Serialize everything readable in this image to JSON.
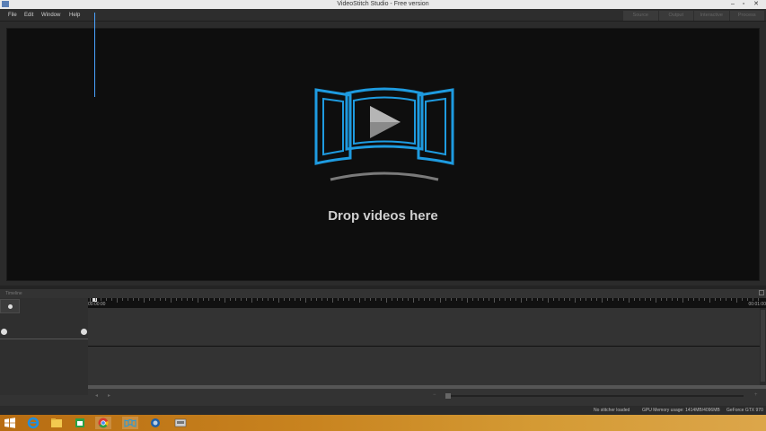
{
  "window": {
    "title": "VideoStitch Studio - Free version",
    "min": "–",
    "max": "▫",
    "close": "✕"
  },
  "menu": [
    "File",
    "Edit",
    "Window",
    "Help"
  ],
  "mode_tabs": [
    "Source",
    "Output",
    "Interactive",
    "Process"
  ],
  "viewer": {
    "drop_text": "Drop videos here"
  },
  "timeline": {
    "label": "Timeline",
    "start_time": "00:00:00",
    "end_time": "00:01:00",
    "prev_btn": "◂",
    "next_btn": "▸",
    "zoom_out": "−",
    "zoom_in": "+"
  },
  "status": {
    "stitcher": "No stitcher loaded",
    "gpu_memory": "GPU Memory usage: 1414MB/4096MB",
    "gpu": "GeForce GTX 970"
  },
  "taskbar": {
    "icons": [
      "windows-start-icon",
      "internet-explorer-icon",
      "file-explorer-icon",
      "store-icon",
      "chrome-icon",
      "videostitch-icon",
      "app-icon",
      "terminal-icon"
    ]
  },
  "colors": {
    "accent": "#1e9be0",
    "background": "#0e0e0e",
    "panel": "#333333"
  }
}
